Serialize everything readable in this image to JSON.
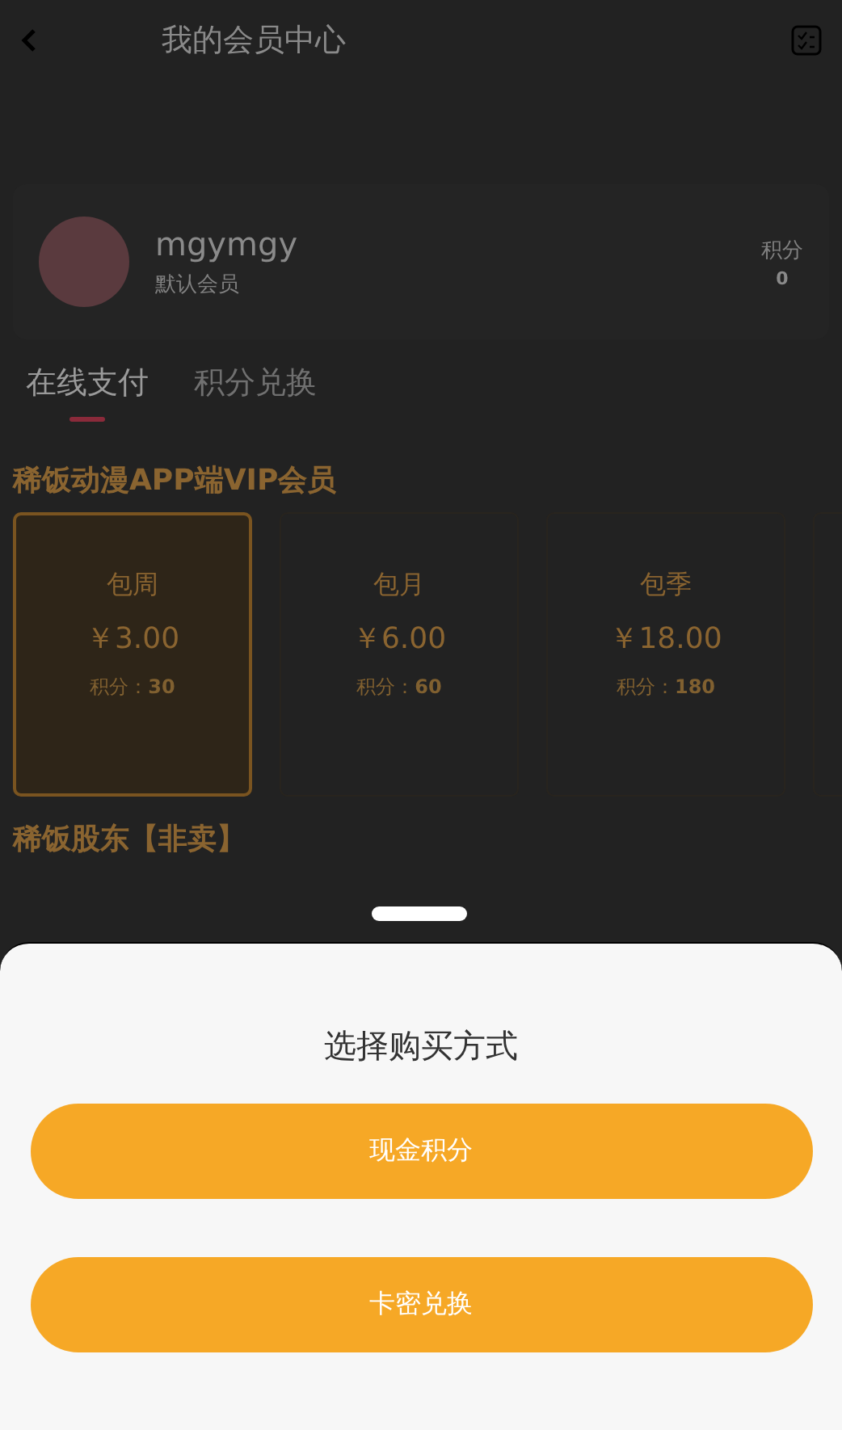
{
  "header": {
    "title": "我的会员中心"
  },
  "profile": {
    "username": "mgymgy",
    "level": "默认会员",
    "points_label": "积分",
    "points": "0"
  },
  "tabs": [
    {
      "label": "在线支付",
      "selected": true
    },
    {
      "label": "积分兑换",
      "selected": false
    }
  ],
  "sections": [
    {
      "title": "稀饭动漫APP端VIP会员",
      "plans": [
        {
          "name": "包周",
          "price": "￥3.00",
          "points_label": "积分：",
          "points": "30",
          "selected": true
        },
        {
          "name": "包月",
          "price": "￥6.00",
          "points_label": "积分：",
          "points": "60",
          "selected": false
        },
        {
          "name": "包季",
          "price": "￥18.00",
          "points_label": "积分：",
          "points": "180",
          "selected": false
        },
        {
          "selected": false
        }
      ]
    },
    {
      "title": "稀饭股东【非卖】"
    }
  ],
  "sheet": {
    "title": "选择购买方式",
    "buttons": [
      "现金积分",
      "卡密兑换"
    ]
  }
}
